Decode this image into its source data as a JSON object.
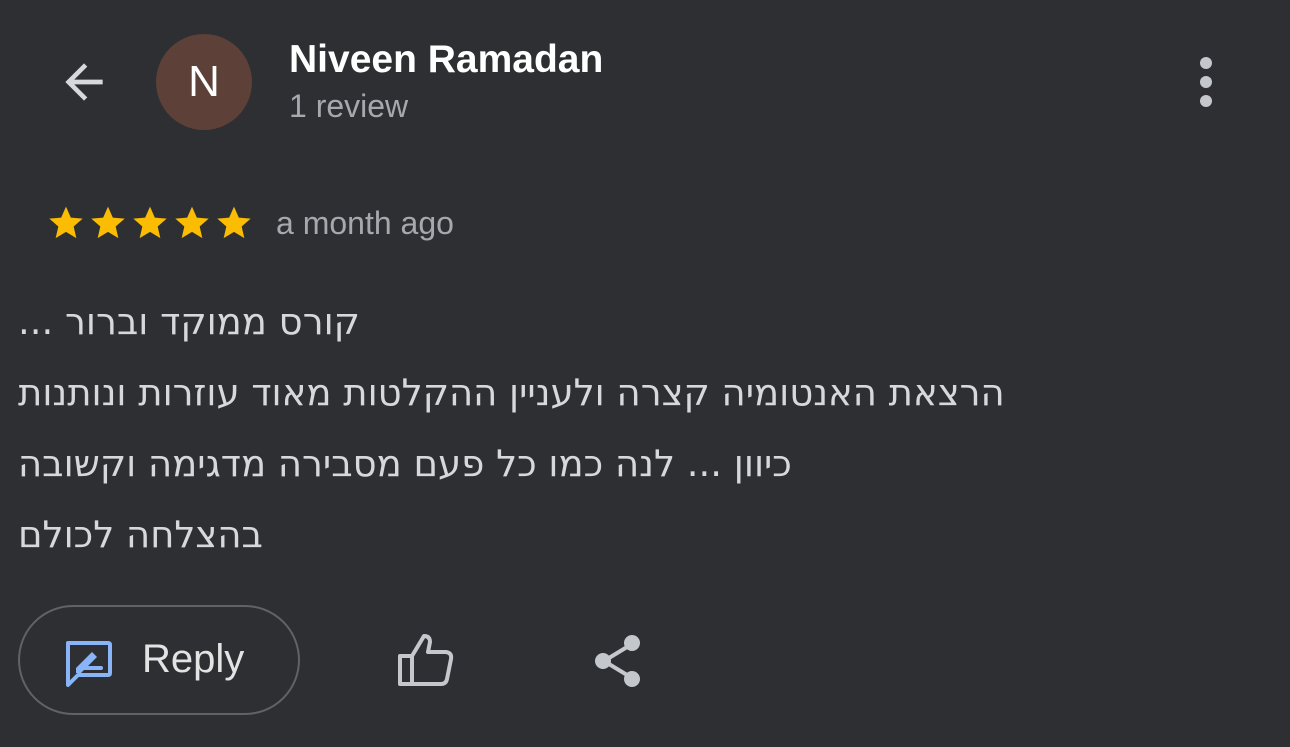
{
  "header": {
    "back_icon": "arrow-back-icon",
    "avatar_initial": "N",
    "avatar_color": "#5d4037",
    "reviewer_name": "Niveen Ramadan",
    "review_count": "1 review",
    "more_icon": "more-vertical-icon"
  },
  "review": {
    "rating": 5,
    "rating_max": 5,
    "star_color": "#fbbc04",
    "timestamp": "a month ago",
    "lines": [
      "קורס ממוקד וברור ...",
      "הרצאת האנטומיה קצרה ולעניין ההקלטות מאוד עוזרות ונותנות",
      "כיוון ... לנה כמו כל פעם מסבירה מדגימה וקשובה",
      "בהצלחה לכולם"
    ]
  },
  "actions": {
    "reply_label": "Reply",
    "reply_icon": "reply-edit-icon",
    "like_icon": "thumb-up-icon",
    "share_icon": "share-icon",
    "accent_color": "#8ab4f8"
  }
}
